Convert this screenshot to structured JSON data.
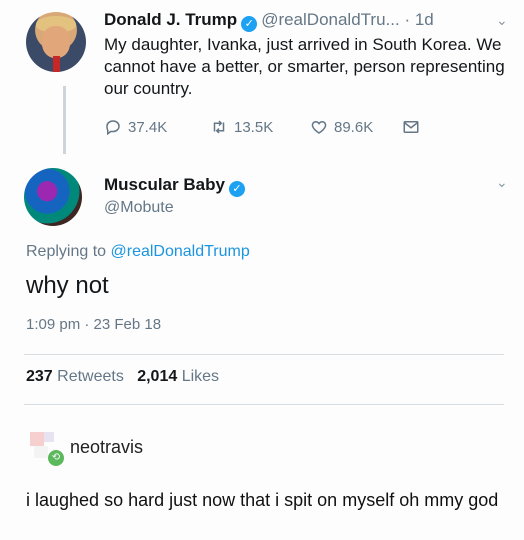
{
  "tweet1": {
    "name": "Donald J. Trump",
    "handle": "@realDonaldTru...",
    "time": "· 1d",
    "text": "My daughter, Ivanka, just arrived in South Korea. We cannot have a better, or smarter, person representing our country.",
    "replies": "37.4K",
    "retweets": "13.5K",
    "likes": "89.6K"
  },
  "tweet2": {
    "name": "Muscular Baby",
    "handle": "@Mobute",
    "replying_prefix": "Replying to",
    "replying_to": "@realDonaldTrump",
    "text": "why not",
    "timestamp": "1:09 pm · 23 Feb 18",
    "retweets_count": "237",
    "retweets_label": "Retweets",
    "likes_count": "2,014",
    "likes_label": "Likes"
  },
  "comment": {
    "username": "neotravis",
    "text": "i laughed so hard just now that i  spit  on myself oh mmy god"
  },
  "icons": {
    "verified": "verified-badge-icon",
    "chevron": "chevron-down-icon",
    "reply": "reply-icon",
    "retweet": "retweet-icon",
    "like": "heart-icon",
    "dm": "envelope-icon"
  },
  "colors": {
    "verified_blue": "#1da1f2",
    "mention_blue": "#1b95e0",
    "secondary_text": "#657786"
  }
}
